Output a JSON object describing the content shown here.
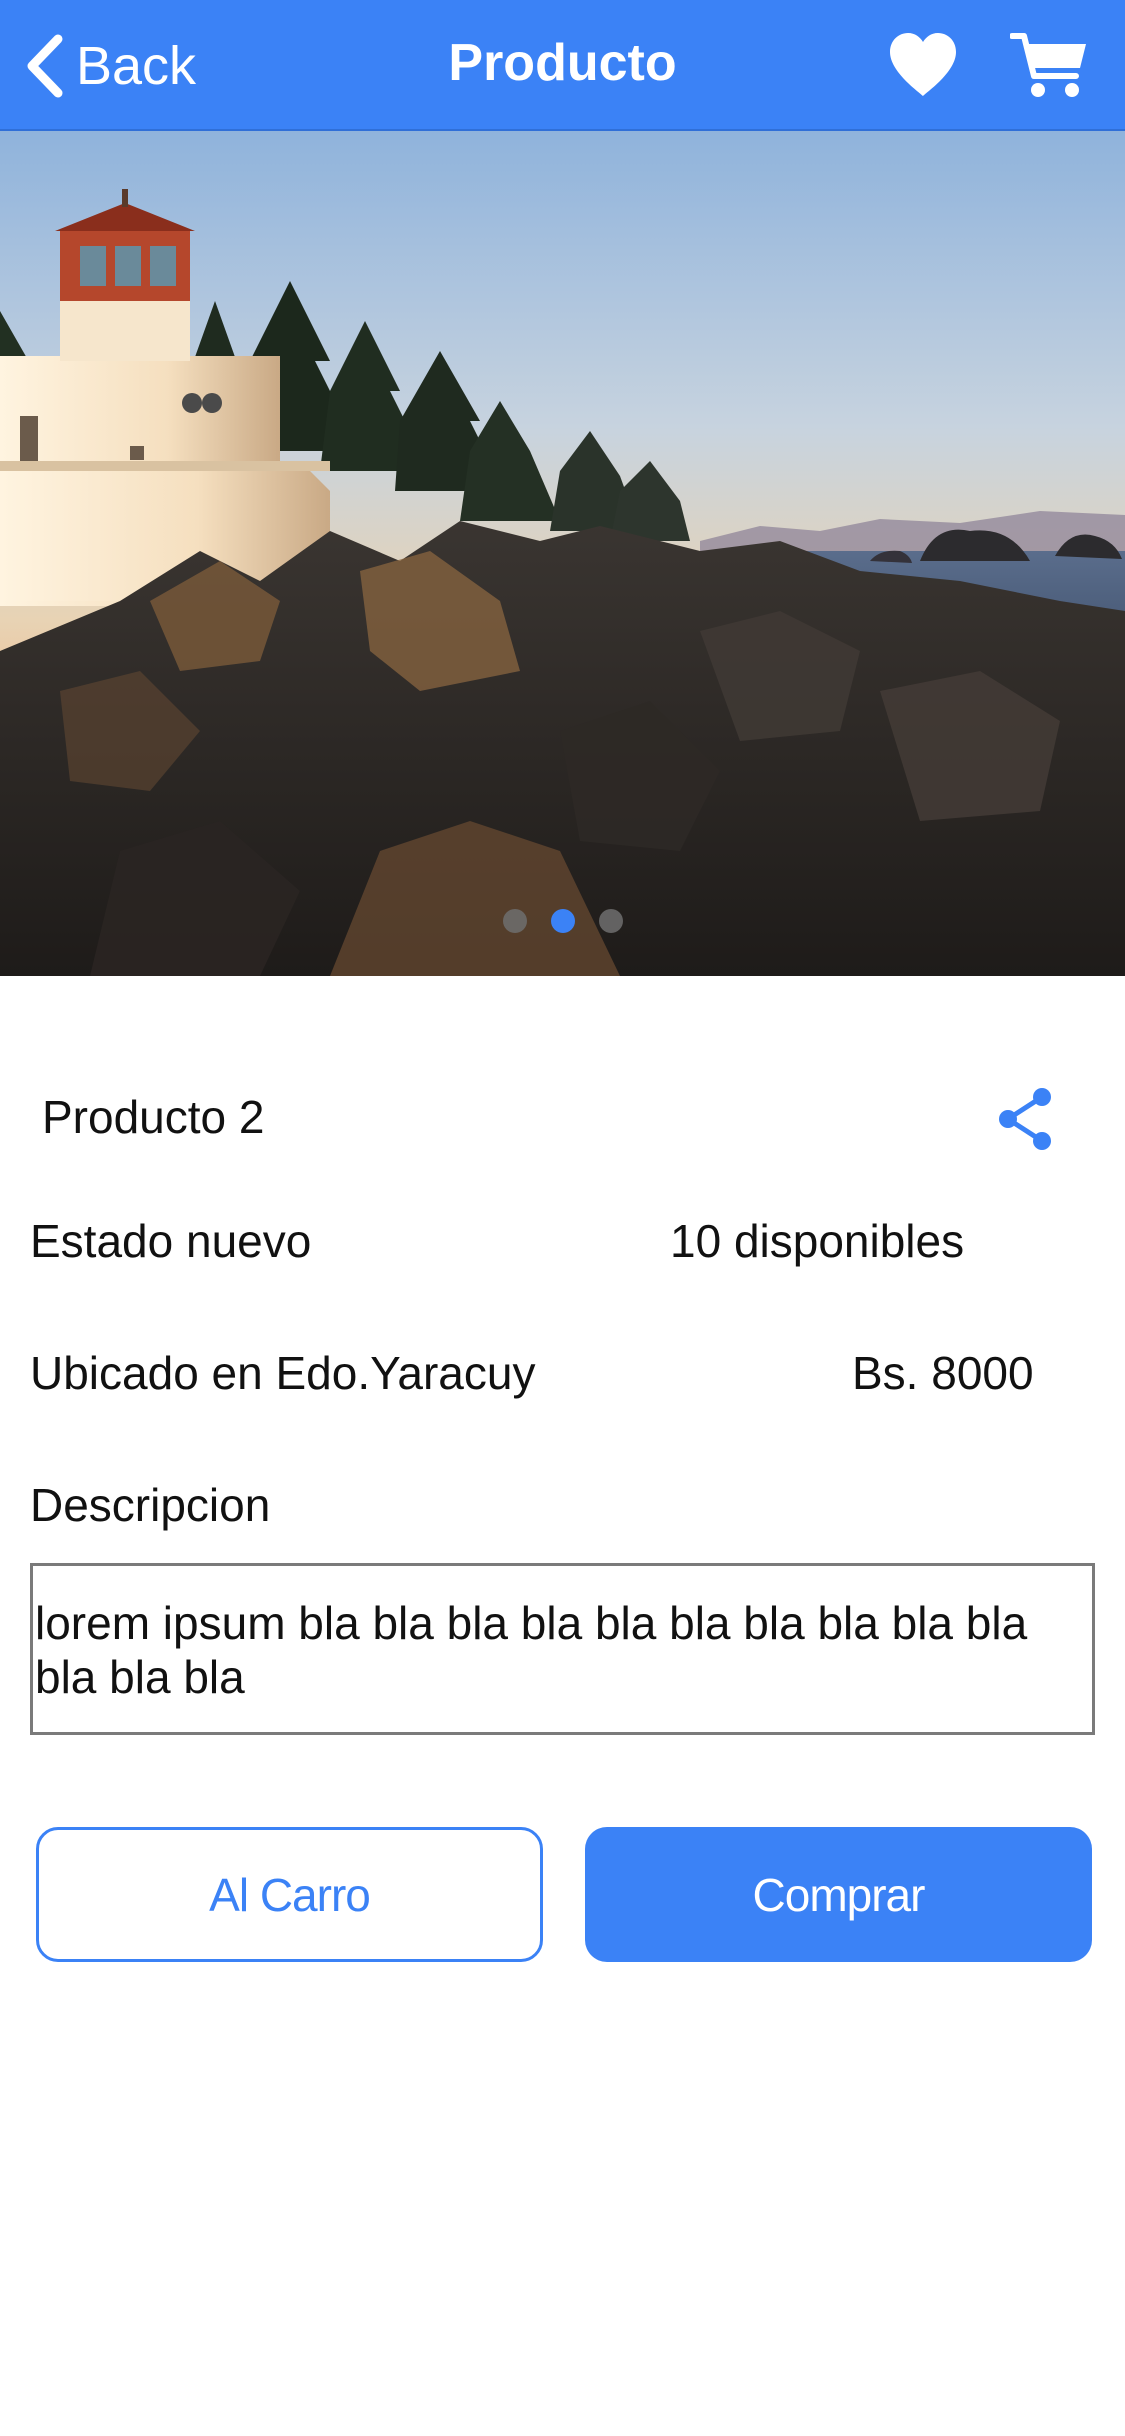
{
  "header": {
    "back_label": "Back",
    "title": "Producto",
    "favorite_icon": "heart-icon",
    "cart_icon": "cart-icon",
    "background_color": "#3b82f6"
  },
  "carousel": {
    "image_description_icon": "lighthouse-photo",
    "slide_count": 3,
    "active_index": 1
  },
  "product": {
    "name": "Producto 2",
    "share_icon": "share-icon",
    "condition": "Estado nuevo",
    "stock": "10 disponibles",
    "location": "Ubicado en Edo.Yaracuy",
    "price": "Bs. 8000",
    "description_label": "Descripcion",
    "description": "lorem ipsum bla bla bla bla bla bla bla bla bla bla bla bla bla"
  },
  "actions": {
    "add_to_cart_label": "Al Carro",
    "buy_label": "Comprar"
  },
  "colors": {
    "accent": "#3b82f6",
    "text": "#111111"
  }
}
